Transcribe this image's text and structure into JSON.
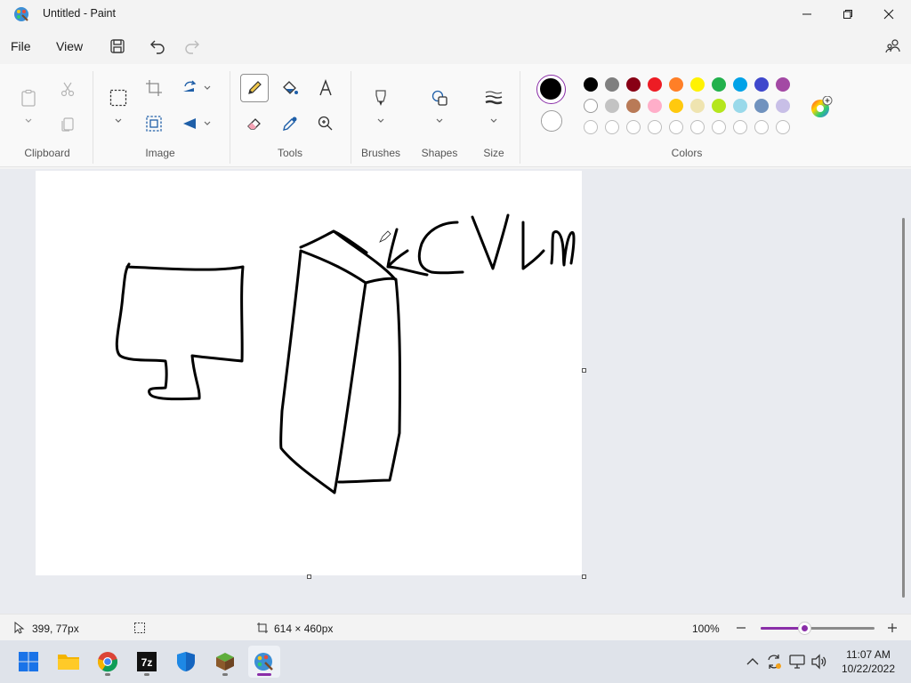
{
  "window": {
    "title": "Untitled - Paint"
  },
  "menu": {
    "file": "File",
    "view": "View"
  },
  "ribbon": {
    "groups": {
      "clipboard": "Clipboard",
      "image": "Image",
      "tools": "Tools",
      "brushes": "Brushes",
      "shapes": "Shapes",
      "size": "Size",
      "colors": "Colors"
    },
    "primary_color": "#000000",
    "secondary_color": "#ffffff",
    "palette_row1": [
      "#000000",
      "#7f7f7f",
      "#880015",
      "#ed1c24",
      "#ff7f27",
      "#fff200",
      "#22b14c",
      "#00a2e8",
      "#3f48cc",
      "#a349a4"
    ],
    "palette_row2": [
      "#ffffff",
      "#c3c3c3",
      "#b97a57",
      "#ffaec9",
      "#ffc90e",
      "#efe4b0",
      "#b5e61d",
      "#99d9ea",
      "#7092be",
      "#c8bfe7"
    ]
  },
  "status": {
    "cursor_position": "399, 77px",
    "canvas_size": "614 × 460px",
    "zoom": "100%",
    "zoom_level": 0.38
  },
  "taskbar": {
    "time": "11:07 AM",
    "date": "10/22/2022"
  }
}
